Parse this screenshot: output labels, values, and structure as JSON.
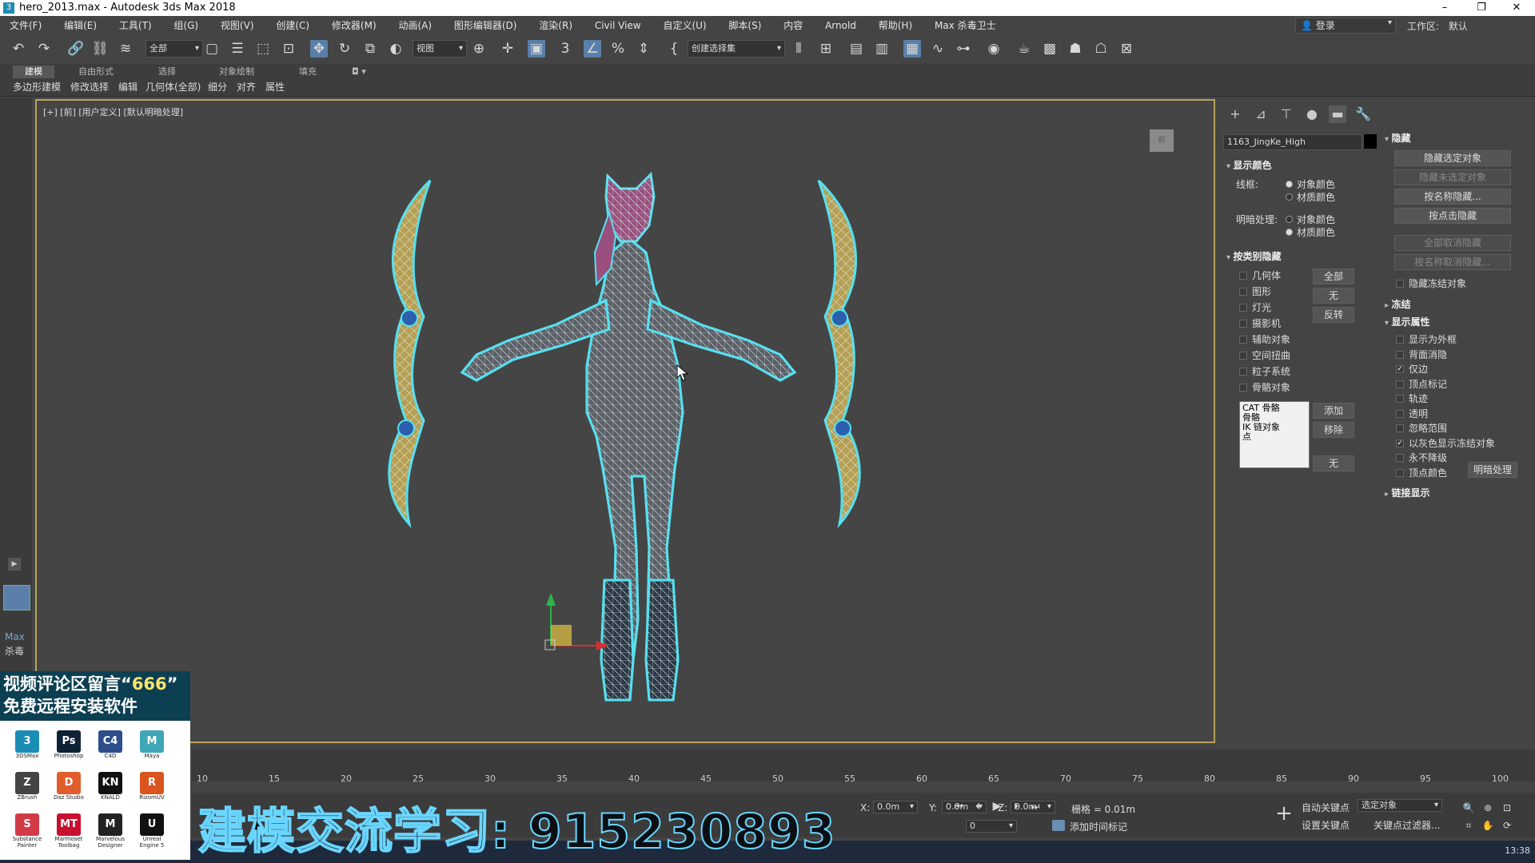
{
  "window": {
    "title": "hero_2013.max - Autodesk 3ds Max 2018",
    "app_icon": "3"
  },
  "menus": [
    "文件(F)",
    "编辑(E)",
    "工具(T)",
    "组(G)",
    "视图(V)",
    "创建(C)",
    "修改器(M)",
    "动画(A)",
    "图形编辑器(D)",
    "渲染(R)",
    "Civil View",
    "自定义(U)",
    "脚本(S)",
    "内容",
    "Arnold",
    "帮助(H)",
    "Max 杀毒卫士"
  ],
  "account": {
    "login": "登录",
    "workspace_label": "工作区:",
    "workspace_value": "默认"
  },
  "toolbar": {
    "filter_value": "全部",
    "ref_coord": "视图",
    "selection_set": "创建选择集"
  },
  "ribbon": {
    "tabs": [
      "建模",
      "自由形式",
      "选择",
      "对象绘制",
      "填充"
    ],
    "subtabs": [
      "多边形建模",
      "修改选择",
      "编辑",
      "几何体(全部)",
      "细分",
      "对齐",
      "属性"
    ]
  },
  "left_strip": {
    "max_label": "Max",
    "virus_label": "杀毒"
  },
  "viewport": {
    "label": "[+] [前] [用户定义] [默认明暗处理]",
    "viewcube": "前"
  },
  "command_panel": {
    "object_name": "1163_JingKe_High",
    "display_color": {
      "title": "显示颜色",
      "wireframe_label": "线框:",
      "shaded_label": "明暗处理:",
      "opt_object": "对象颜色",
      "opt_material": "材质颜色"
    },
    "hide_by_category": {
      "title": "按类别隐藏",
      "items": [
        "几何体",
        "图形",
        "灯光",
        "摄影机",
        "辅助对象",
        "空间扭曲",
        "粒子系统",
        "骨骼对象"
      ],
      "btn_all": "全部",
      "btn_none": "无",
      "btn_invert": "反转",
      "list": [
        "CAT 骨骼",
        "骨骼",
        "IK 链对象",
        "点"
      ],
      "btn_add": "添加",
      "btn_remove": "移除",
      "btn_none2": "无"
    },
    "hide": {
      "title": "隐藏",
      "btn_hide_sel": "隐藏选定对象",
      "btn_hide_unsel": "隐藏未选定对象",
      "btn_hide_name": "按名称隐藏...",
      "btn_hide_hit": "按点击隐藏",
      "btn_unhide_all": "全部取消隐藏",
      "btn_unhide_name": "按名称取消隐藏...",
      "chk_hide_frozen": "隐藏冻结对象"
    },
    "freeze": {
      "title": "冻结"
    },
    "display_props": {
      "title": "显示属性",
      "items": [
        {
          "label": "显示为外框",
          "checked": false
        },
        {
          "label": "背面消隐",
          "checked": false
        },
        {
          "label": "仅边",
          "checked": true
        },
        {
          "label": "顶点标记",
          "checked": false
        },
        {
          "label": "轨迹",
          "checked": false
        },
        {
          "label": "透明",
          "checked": false
        },
        {
          "label": "忽略范围",
          "checked": false
        },
        {
          "label": "以灰色显示冻结对象",
          "checked": true
        },
        {
          "label": "永不降级",
          "checked": false
        },
        {
          "label": "顶点颜色",
          "checked": false
        }
      ],
      "btn_shaded": "明暗处理"
    },
    "link_display": {
      "title": "链接显示"
    }
  },
  "timeline": {
    "ticks": [
      "10",
      "15",
      "20",
      "25",
      "30",
      "35",
      "40",
      "45",
      "50",
      "55",
      "60",
      "65",
      "70",
      "75",
      "80",
      "85",
      "90",
      "95",
      "100"
    ]
  },
  "status": {
    "x_label": "X:",
    "x_value": "0.0m",
    "y_label": "Y:",
    "y_value": "0.0m",
    "z_label": "Z:",
    "z_value": "0.0m",
    "grid": "栅格 = 0.01m",
    "add_time_tag": "添加时间标记",
    "auto_key": "自动关键点",
    "set_key": "设置关键点",
    "selected_obj": "选定对象",
    "key_filters": "关键点过滤器...",
    "frame": "0"
  },
  "clock": "13:38",
  "promo": {
    "line1_a": "视频评论区留言“",
    "line1_b": "666",
    "line1_c": "”",
    "line2": "免费远程安装软件",
    "apps": [
      {
        "icon": "3",
        "name": "3DSMax",
        "color": "#1a8db5"
      },
      {
        "icon": "Ps",
        "name": "Photoshop",
        "color": "#0e2236"
      },
      {
        "icon": "C4",
        "name": "C4D",
        "color": "#2d4e8a"
      },
      {
        "icon": "M",
        "name": "Maya",
        "color": "#3fa7b5"
      },
      {
        "icon": "Z",
        "name": "ZBrush",
        "color": "#444444"
      },
      {
        "icon": "D",
        "name": "Daz Studio",
        "color": "#e25d2c"
      },
      {
        "icon": "KN",
        "name": "KNALD",
        "color": "#111111"
      },
      {
        "icon": "R",
        "name": "RizomUV",
        "color": "#d9541e"
      },
      {
        "icon": "S",
        "name": "Substance Painter",
        "color": "#d33a48"
      },
      {
        "icon": "MT",
        "name": "Marmoset Toolbag",
        "color": "#c8102e"
      },
      {
        "icon": "M",
        "name": "Marvelous Designer",
        "color": "#222222"
      },
      {
        "icon": "U",
        "name": "Unreal Engine 5",
        "color": "#111111"
      }
    ]
  },
  "overlay_text": "建模交流学习: 915230893"
}
